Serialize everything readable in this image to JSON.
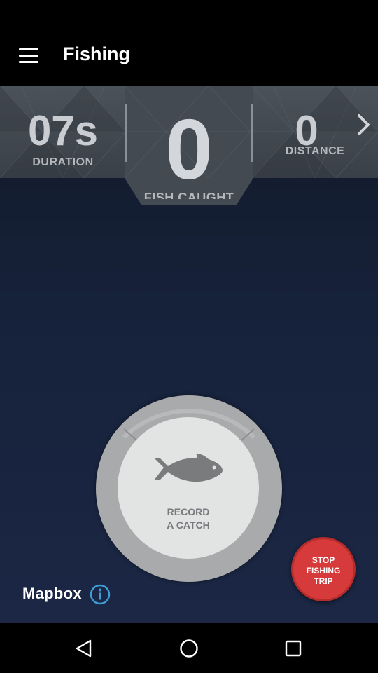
{
  "app_bar": {
    "title": "Fishing",
    "menu_icon": "hamburger-menu-icon"
  },
  "stats": {
    "duration_value": "07s",
    "duration_label": "DURATION",
    "fish_caught_value": "0",
    "fish_caught_label": "FISH CAUGHT",
    "distance_value": "0",
    "distance_label": "DISTANCE",
    "next_icon": "chevron-right-icon"
  },
  "record": {
    "line1": "RECORD",
    "line2": "A CATCH",
    "icon": "fish-icon"
  },
  "stop": {
    "line1": "STOP",
    "line2": "FISHING",
    "line3": "TRIP",
    "color": "#d63a3a"
  },
  "map": {
    "attribution": "Mapbox",
    "info_icon": "info-icon",
    "accent": "#3d9bd6"
  },
  "nav": {
    "back_icon": "back-triangle-icon",
    "home_icon": "home-circle-icon",
    "recent_icon": "recent-square-icon"
  }
}
